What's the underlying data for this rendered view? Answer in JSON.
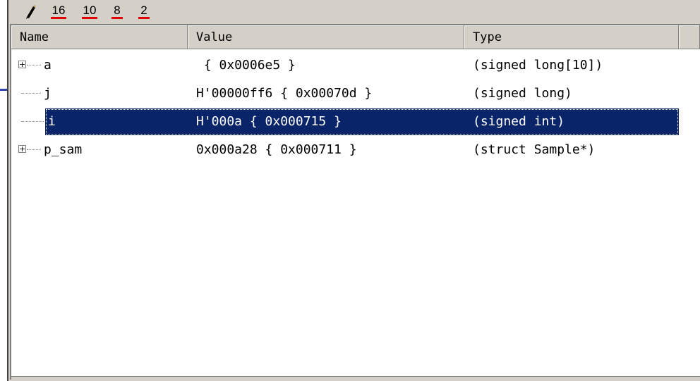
{
  "toolbar": {
    "radix_buttons": [
      {
        "label": "16"
      },
      {
        "label": "10"
      },
      {
        "label": "8"
      },
      {
        "label": "2"
      }
    ],
    "icons": {
      "edit": "pencil-icon"
    }
  },
  "columns": [
    {
      "label": "Name"
    },
    {
      "label": "Value"
    },
    {
      "label": "Type"
    },
    {
      "label": ""
    }
  ],
  "rows": [
    {
      "name": "a",
      "value": " { 0x0006e5 }",
      "type": "(signed long[10])",
      "expandable": true,
      "selected": false
    },
    {
      "name": "j",
      "value": "H'00000ff6 { 0x00070d }",
      "type": "(signed long)",
      "expandable": false,
      "selected": false
    },
    {
      "name": "i",
      "value": "H'000a { 0x000715 }",
      "type": "(signed int)",
      "expandable": false,
      "selected": true
    },
    {
      "name": "p_sam",
      "value": "0x000a28 { 0x000711 }",
      "type": "(struct Sample*)",
      "expandable": true,
      "selected": false
    }
  ],
  "colors": {
    "selection": "#0a246a",
    "radix_underline": "#e00000",
    "chrome": "#d4d0c8"
  }
}
